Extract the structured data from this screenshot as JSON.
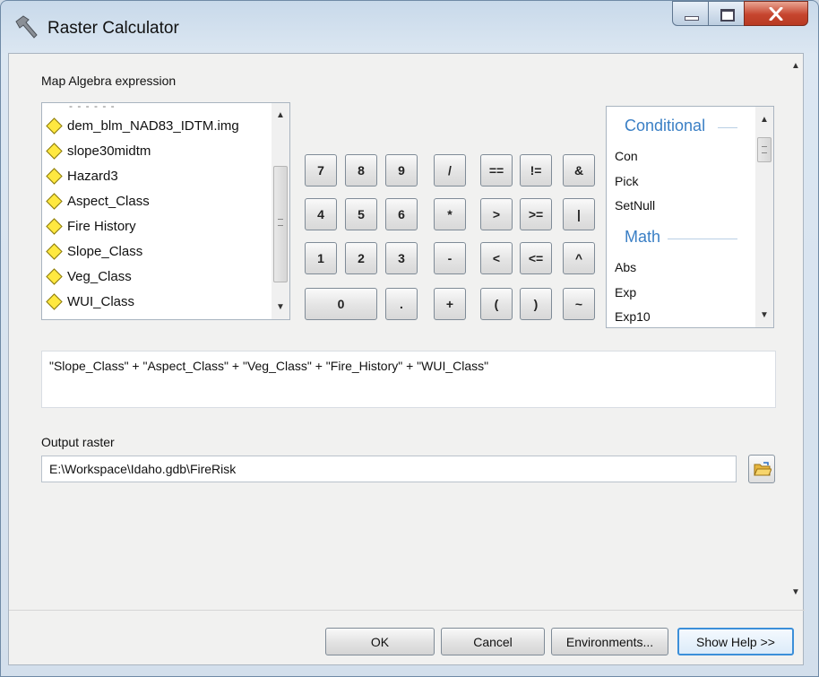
{
  "window": {
    "title": "Raster Calculator"
  },
  "expression_label": "Map Algebra expression",
  "layers": [
    "dem_blm_NAD83_IDTM.img",
    "slope30midtm",
    "Hazard3",
    "Aspect_Class",
    "Fire History",
    "Slope_Class",
    "Veg_Class",
    "WUI_Class"
  ],
  "keypad": {
    "row1": [
      "7",
      "8",
      "9",
      "/",
      "==",
      "!=",
      "&"
    ],
    "row2": [
      "4",
      "5",
      "6",
      "*",
      ">",
      ">=",
      "|"
    ],
    "row3": [
      "1",
      "2",
      "3",
      "-",
      "<",
      "<=",
      "^"
    ],
    "row4": [
      "0",
      ".",
      "+",
      "(",
      ")",
      "~"
    ]
  },
  "functions": {
    "conditional_header": "Conditional",
    "conditional_items": [
      "Con",
      "Pick",
      "SetNull"
    ],
    "math_header": "Math",
    "math_items": [
      "Abs",
      "Exp",
      "Exp10"
    ]
  },
  "expression": "\"Slope_Class\" + \"Aspect_Class\" + \"Veg_Class\" + \"Fire_History\" + \"WUI_Class\"",
  "output_label": "Output raster",
  "output_value": "E:\\Workspace\\Idaho.gdb\\FireRisk",
  "buttons": {
    "ok": "OK",
    "cancel": "Cancel",
    "environments": "Environments...",
    "show_help": "Show Help >>"
  },
  "icons": [
    "hammer-icon",
    "minimize-icon",
    "maximize-icon",
    "close-icon",
    "layer-diamond-icon",
    "browse-folder-icon"
  ],
  "colors": {
    "category_header": "#3a7fc5",
    "layer_icon": "#ffe840",
    "default_button_border": "#3c8fd9",
    "close_button": "#c6452e"
  }
}
